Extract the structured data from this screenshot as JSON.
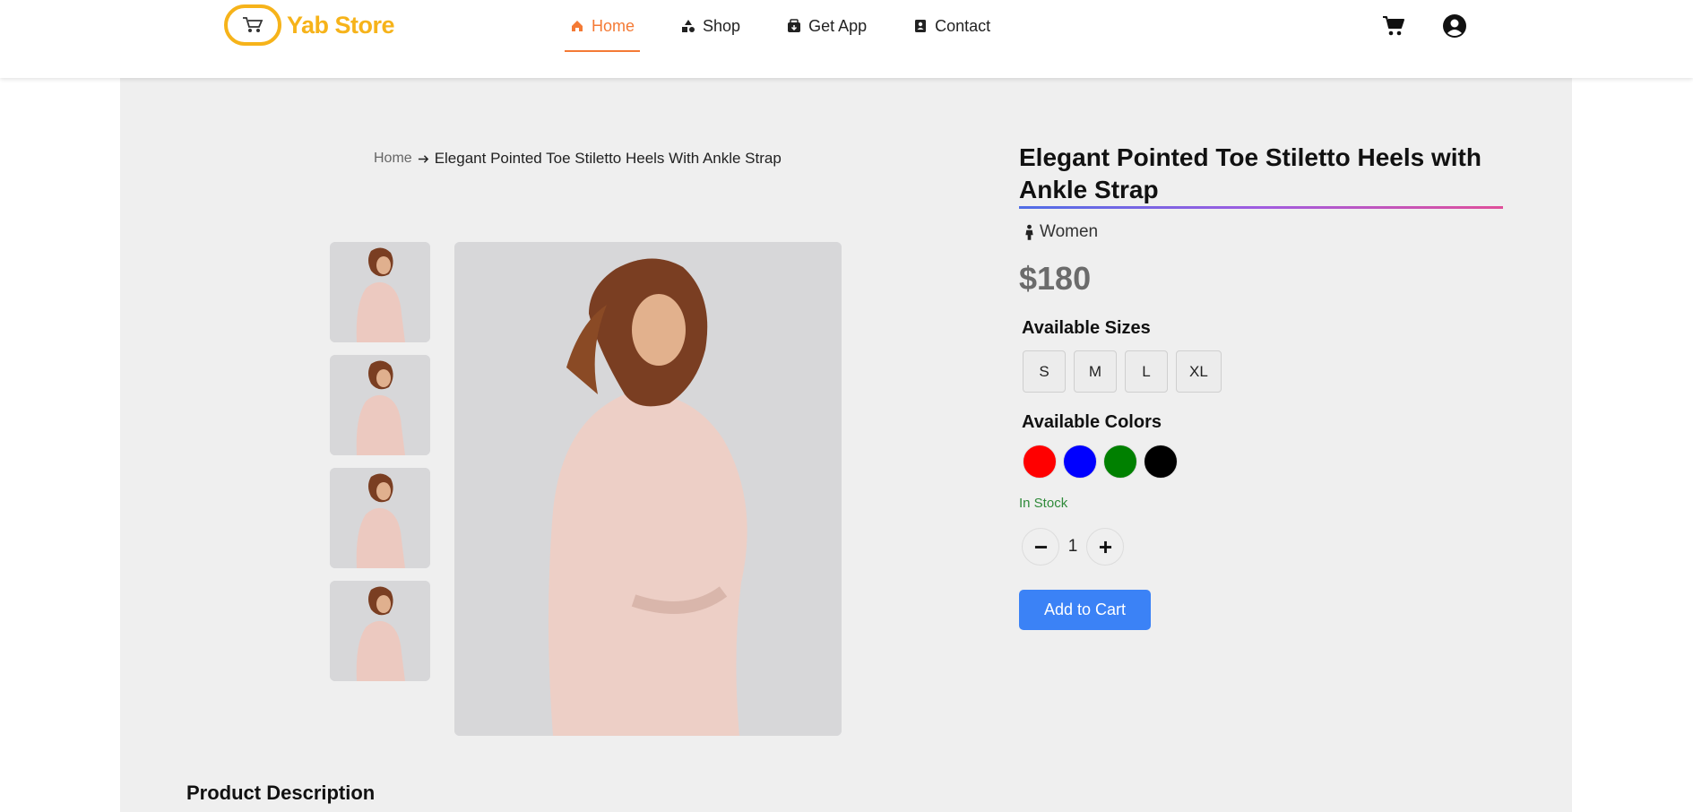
{
  "brand": {
    "name": "Yab Store",
    "accent": "#f6b31a"
  },
  "nav": {
    "items": [
      {
        "label": "Home",
        "icon": "home-icon",
        "active": true
      },
      {
        "label": "Shop",
        "icon": "shapes-icon",
        "active": false
      },
      {
        "label": "Get App",
        "icon": "app-icon",
        "active": false
      },
      {
        "label": "Contact",
        "icon": "contact-icon",
        "active": false
      }
    ],
    "active_color": "#f47a35"
  },
  "header_icons": [
    "cart-icon",
    "user-circle-icon"
  ],
  "breadcrumb": {
    "home": "Home",
    "current": "Elegant Pointed Toe Stiletto Heels With Ankle Strap"
  },
  "product": {
    "title": "Elegant Pointed Toe Stiletto Heels with Ankle Strap",
    "category": "Women",
    "price": "$180",
    "sizes_label": "Available Sizes",
    "sizes": [
      "S",
      "M",
      "L",
      "XL"
    ],
    "colors_label": "Available Colors",
    "colors": [
      "#ff0000",
      "#0000ff",
      "#008000",
      "#000000"
    ],
    "stock": "In Stock",
    "quantity": "1",
    "add_to_cart": "Add to Cart"
  },
  "description": {
    "title": "Product Description"
  }
}
